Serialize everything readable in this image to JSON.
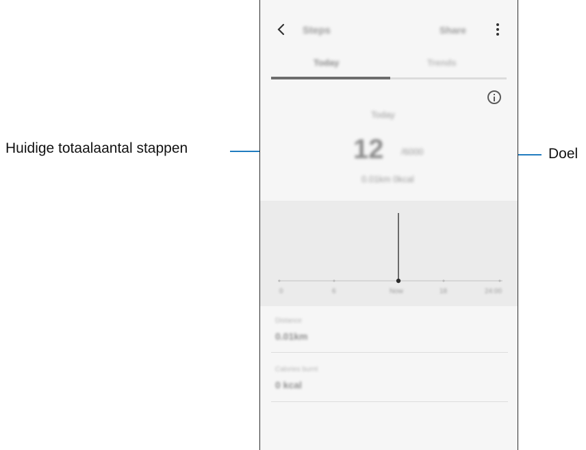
{
  "screen": {
    "title": "Steps",
    "top_action": "Share",
    "tabs": [
      "Today",
      "Trends"
    ],
    "today_label": "Today",
    "step_count": "12",
    "goal_value": "/6000",
    "step_sub": "0.01km 0kcal",
    "chart_ticks": [
      "0",
      "6",
      "Now",
      "18",
      "24:00"
    ],
    "distance_label": "Distance",
    "distance_value": "0.01km",
    "calories_label": "Calories burnt",
    "calories_value": "0 kcal"
  },
  "callouts": {
    "current_steps": "Huidige totaalaantal stappen",
    "goal": "Doel"
  },
  "colors": {
    "callout_line": "#1f7bbf",
    "screen_bg": "#f6f6f6",
    "chart_bg": "#ebebeb"
  },
  "icons": {
    "back": "chevron-left-icon",
    "more": "more-vertical-icon",
    "info": "info-icon"
  }
}
